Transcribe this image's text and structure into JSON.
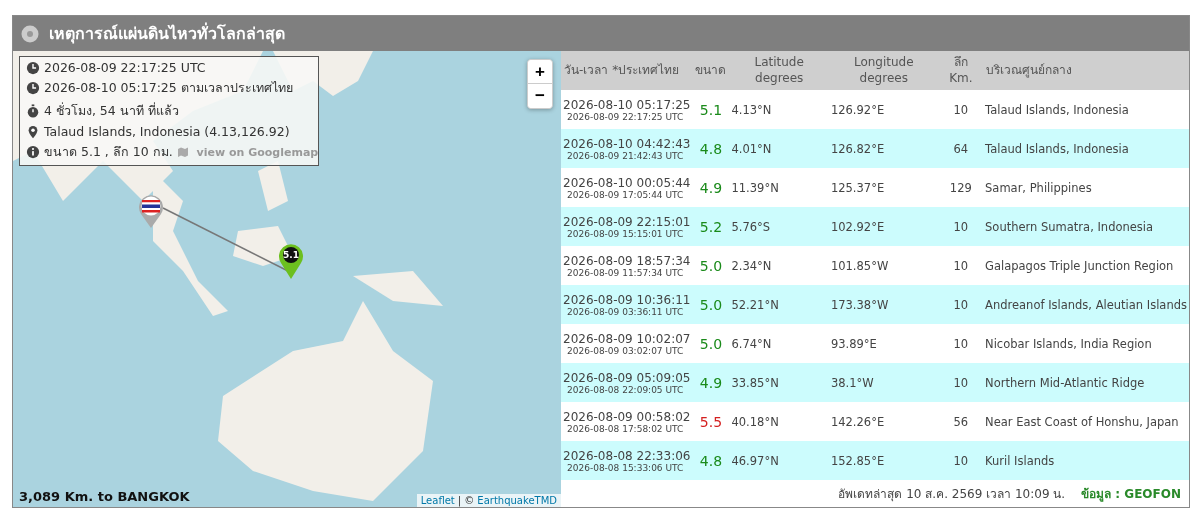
{
  "panel": {
    "title": "เหตุการณ์แผ่นดินไหวทั่วโลกล่าสุด"
  },
  "map": {
    "info": [
      {
        "kind": "clock",
        "text": "2026-08-09 22:17:25 UTC"
      },
      {
        "kind": "clock",
        "text": "2026-08-10 05:17:25 ตามเวลาประเทศไทย"
      },
      {
        "kind": "timer",
        "text": "4 ชั่วโมง, 54 นาที ที่แล้ว"
      },
      {
        "kind": "pin",
        "text": "Talaud Islands, Indonesia (4.13,126.92)"
      },
      {
        "kind": "info",
        "text": "ขนาด 5.1 , ลึก 10 กม.",
        "link": "view on Googlemap"
      }
    ],
    "zoom_in": "+",
    "zoom_out": "−",
    "marker": "5.1",
    "distance": "3,089 Km. to BANGKOK",
    "attribution_link": "Leaflet",
    "attribution_sep": "| ©",
    "attribution_owner": "EarthquakeTMD"
  },
  "table": {
    "columns": [
      "วัน-เวลา *ประเทศไทย",
      "ขนาด",
      "Latitude degrees",
      "Longitude degrees",
      "ลึก Km.",
      "บริเวณศูนย์กลาง"
    ],
    "rows": [
      {
        "local": "2026-08-10 05:17:25",
        "utc": "2026-08-09 22:17:25 UTC",
        "mag": "5.1",
        "color": "#1a8a1a",
        "lat": "4.13°N",
        "lon": "126.92°E",
        "depth": "10",
        "region": "Talaud Islands, Indonesia"
      },
      {
        "local": "2026-08-10 04:42:43",
        "utc": "2026-08-09 21:42:43 UTC",
        "mag": "4.8",
        "color": "#1a8a1a",
        "lat": "4.01°N",
        "lon": "126.82°E",
        "depth": "64",
        "region": "Talaud Islands, Indonesia"
      },
      {
        "local": "2026-08-10 00:05:44",
        "utc": "2026-08-09 17:05:44 UTC",
        "mag": "4.9",
        "color": "#1a8a1a",
        "lat": "11.39°N",
        "lon": "125.37°E",
        "depth": "129",
        "region": "Samar, Philippines"
      },
      {
        "local": "2026-08-09 22:15:01",
        "utc": "2026-08-09 15:15:01 UTC",
        "mag": "5.2",
        "color": "#1a8a1a",
        "lat": "5.76°S",
        "lon": "102.92°E",
        "depth": "10",
        "region": "Southern Sumatra, Indonesia"
      },
      {
        "local": "2026-08-09 18:57:34",
        "utc": "2026-08-09 11:57:34 UTC",
        "mag": "5.0",
        "color": "#1a8a1a",
        "lat": "2.34°N",
        "lon": "101.85°W",
        "depth": "10",
        "region": "Galapagos Triple Junction Region"
      },
      {
        "local": "2026-08-09 10:36:11",
        "utc": "2026-08-09 03:36:11 UTC",
        "mag": "5.0",
        "color": "#1a8a1a",
        "lat": "52.21°N",
        "lon": "173.38°W",
        "depth": "10",
        "region": "Andreanof Islands, Aleutian Islands"
      },
      {
        "local": "2026-08-09 10:02:07",
        "utc": "2026-08-09 03:02:07 UTC",
        "mag": "5.0",
        "color": "#1a8a1a",
        "lat": "6.74°N",
        "lon": "93.89°E",
        "depth": "10",
        "region": "Nicobar Islands, India Region"
      },
      {
        "local": "2026-08-09 05:09:05",
        "utc": "2026-08-08 22:09:05 UTC",
        "mag": "4.9",
        "color": "#1a8a1a",
        "lat": "33.85°N",
        "lon": "38.1°W",
        "depth": "10",
        "region": "Northern Mid-Atlantic Ridge"
      },
      {
        "local": "2026-08-09 00:58:02",
        "utc": "2026-08-08 17:58:02 UTC",
        "mag": "5.5",
        "color": "#d42020",
        "lat": "40.18°N",
        "lon": "142.26°E",
        "depth": "56",
        "region": "Near East Coast of Honshu, Japan"
      },
      {
        "local": "2026-08-08 22:33:06",
        "utc": "2026-08-08 15:33:06 UTC",
        "mag": "4.8",
        "color": "#1a8a1a",
        "lat": "46.97°N",
        "lon": "152.85°E",
        "depth": "10",
        "region": "Kuril Islands"
      }
    ],
    "updated": "อัพเดทล่าสุด 10 ส.ค. 2569 เวลา 10:09 น.",
    "source": "ข้อมูล : GEOFON"
  }
}
